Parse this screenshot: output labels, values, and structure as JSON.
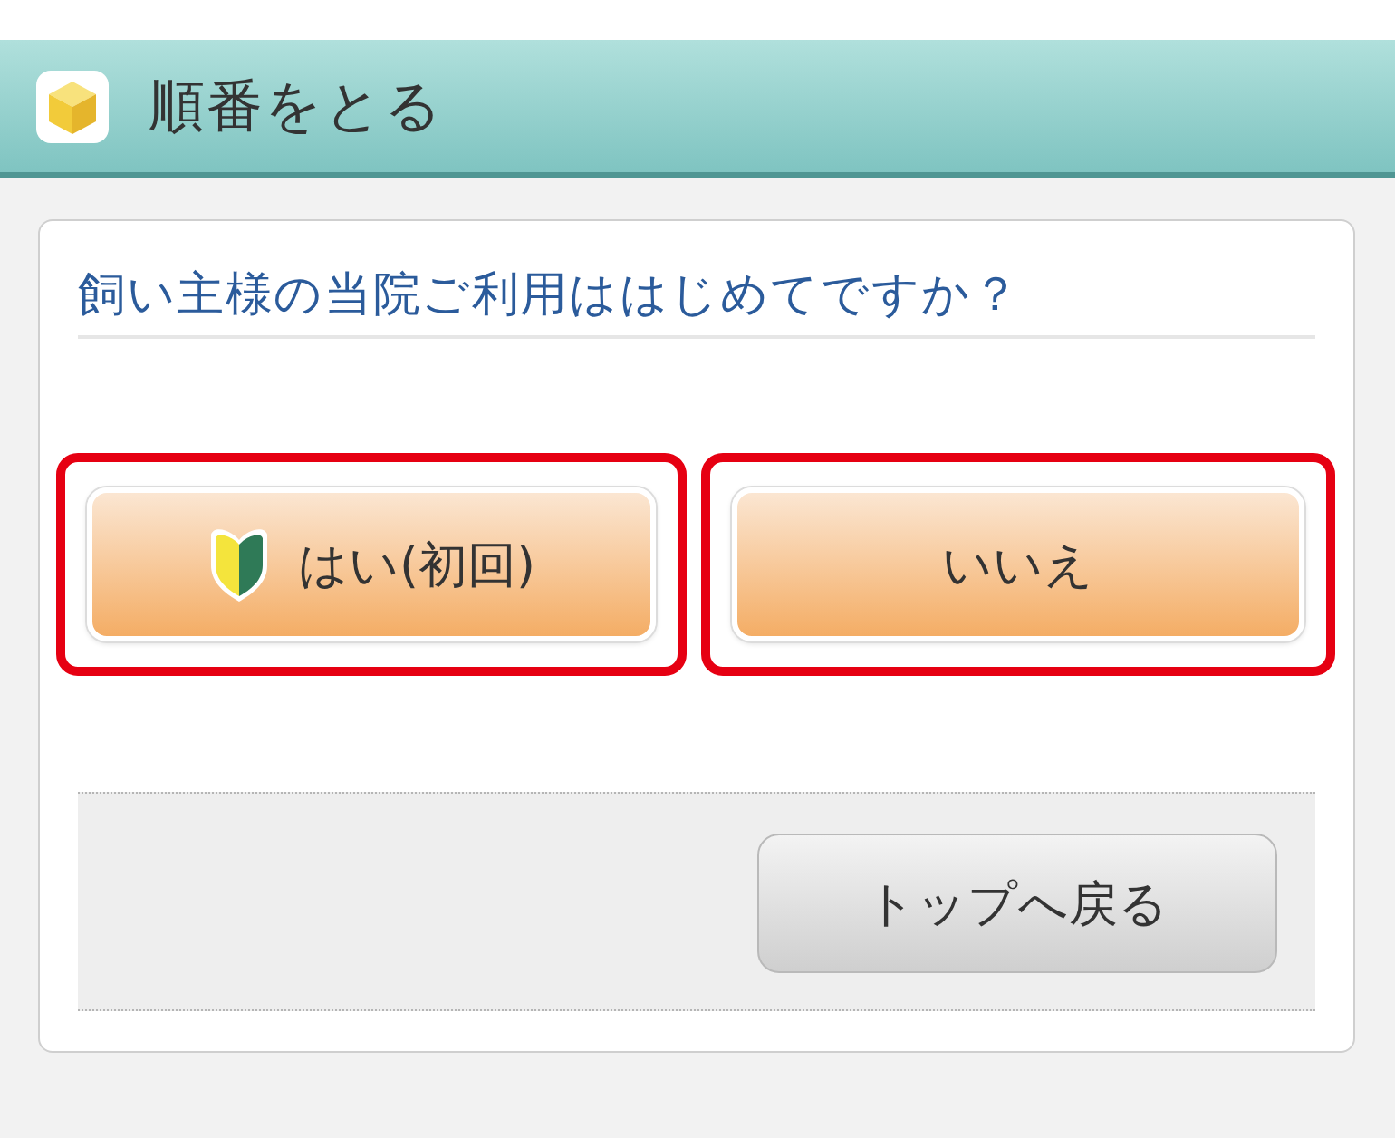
{
  "header": {
    "title": "順番をとる"
  },
  "question": "飼い主様の当院ご利用ははじめてですか？",
  "choices": [
    {
      "kind": "beginner",
      "label": "はい(初回)",
      "highlighted": true
    },
    {
      "kind": "plain",
      "label": "いいえ",
      "highlighted": true
    }
  ],
  "footer": {
    "back_button": "トップへ戻る"
  }
}
